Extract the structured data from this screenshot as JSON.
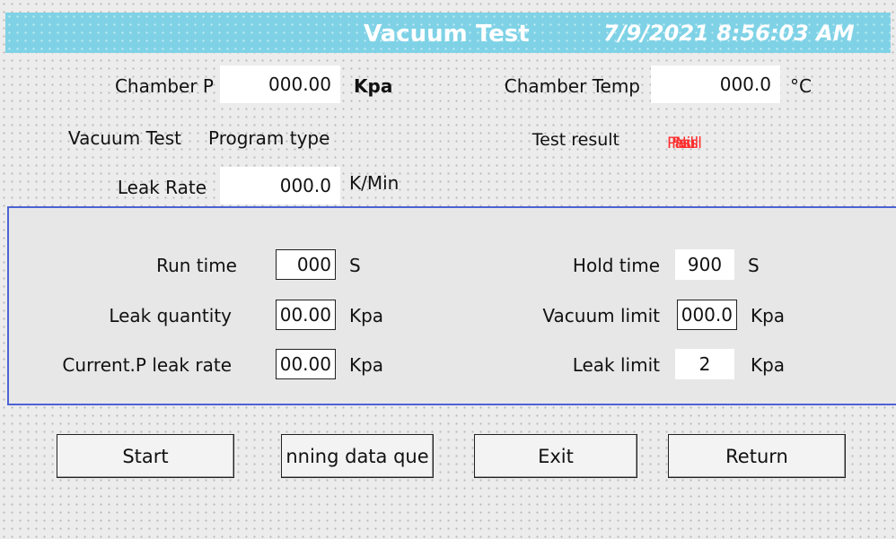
{
  "header": {
    "title": "Vacuum Test",
    "datetime": "7/9/2021 8:56:03 AM"
  },
  "top": {
    "chamber_p_label": "Chamber P",
    "chamber_p_value": "000.00",
    "chamber_p_unit": "Kpa",
    "chamber_temp_label": "Chamber Temp",
    "chamber_temp_value": "000.0",
    "chamber_temp_unit": "°C",
    "vacuum_test_label": "Vacuum Test",
    "program_type_label": "Program type",
    "test_result_label": "Test result",
    "test_result_texts": [
      "Pass",
      "Fail",
      "Null"
    ],
    "leak_rate_label": "Leak Rate",
    "leak_rate_value": "000.0",
    "leak_rate_unit": "K/Min"
  },
  "panel": {
    "run_time_label": "Run time",
    "run_time_value": "000",
    "run_time_unit": "S",
    "hold_time_label": "Hold time",
    "hold_time_value": "900",
    "hold_time_unit": "S",
    "leak_quantity_label": "Leak quantity",
    "leak_quantity_value": "00.00",
    "leak_quantity_unit": "Kpa",
    "vacuum_limit_label": "Vacuum limit",
    "vacuum_limit_value": "000.0",
    "vacuum_limit_unit": "Kpa",
    "current_p_leak_rate_label": "Current.P leak rate",
    "current_p_leak_rate_value": "00.00",
    "current_p_leak_rate_unit": "Kpa",
    "leak_limit_label": "Leak limit",
    "leak_limit_value": "2",
    "leak_limit_unit": "Kpa"
  },
  "buttons": {
    "start": "Start",
    "running_data_query": "nning data que",
    "exit": "Exit",
    "return": "Return"
  },
  "colors": {
    "title_bar": "#7fd2e6",
    "result_text": "#ff2c2c",
    "panel_border": "#4d62d4"
  }
}
